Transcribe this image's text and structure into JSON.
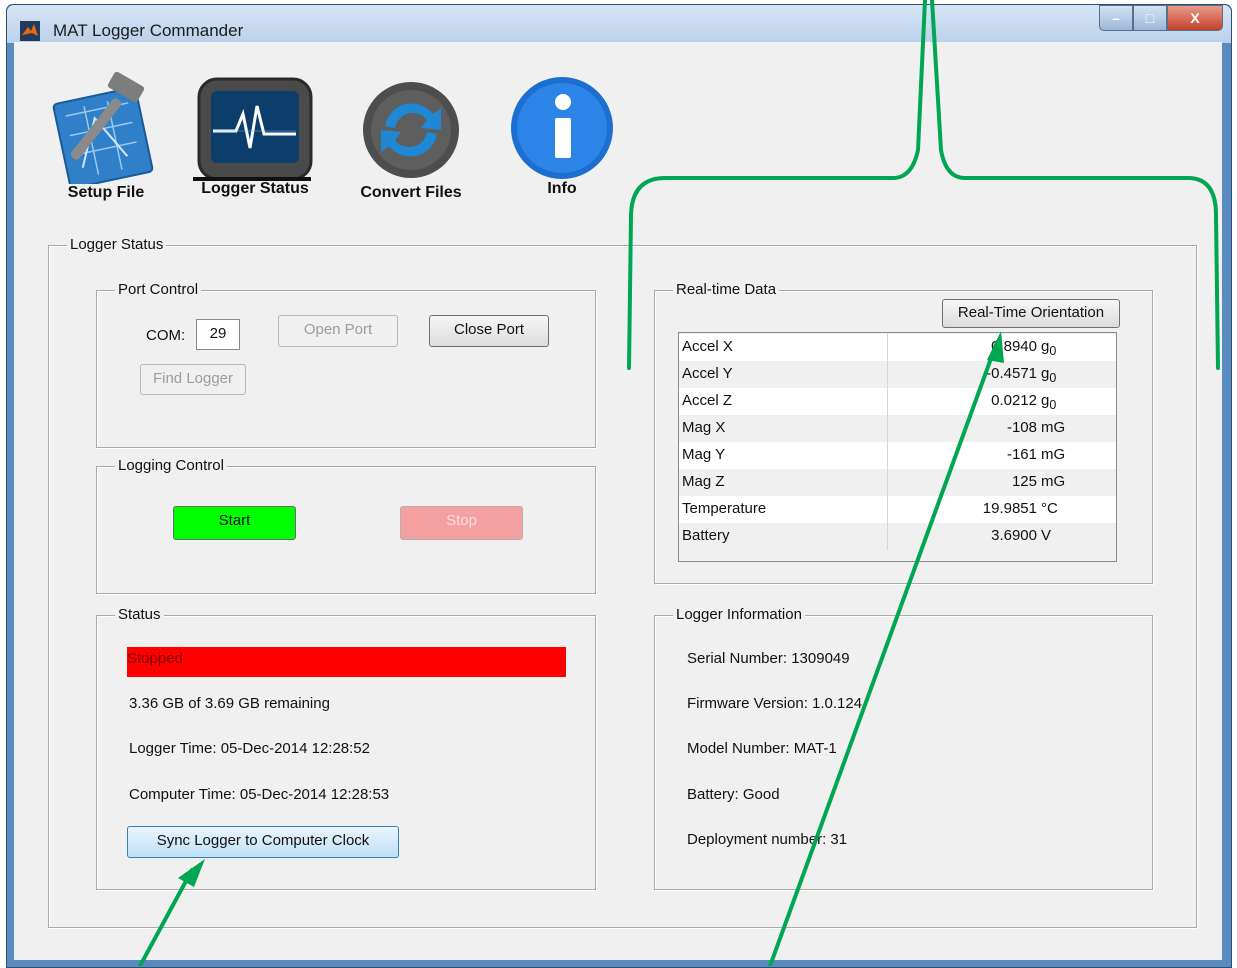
{
  "window": {
    "title": "MAT Logger Commander",
    "minimize": "–",
    "maximize": "□",
    "close": "X"
  },
  "toolbar": [
    {
      "label": "Setup File",
      "icon": "hammer-blueprint-icon"
    },
    {
      "label": "Logger Status",
      "icon": "monitor-pulse-icon"
    },
    {
      "label": "Convert Files",
      "icon": "refresh-arrows-icon"
    },
    {
      "label": "Info",
      "icon": "info-icon"
    }
  ],
  "logger_status": {
    "title": "Logger Status",
    "port_control": {
      "title": "Port Control",
      "com_label": "COM:",
      "com_value": "29",
      "open_port": "Open Port",
      "close_port": "Close Port",
      "find_logger": "Find Logger"
    },
    "logging_control": {
      "title": "Logging Control",
      "start": "Start",
      "stop": "Stop",
      "start_color": "#00ff00",
      "stop_color": "#f4a0a0"
    },
    "status": {
      "title": "Status",
      "state": "Stopped",
      "state_color": "#ff0000",
      "storage": "3.36 GB of 3.69 GB remaining",
      "logger_time": "Logger Time: 05-Dec-2014 12:28:52",
      "computer_time": "Computer Time: 05-Dec-2014 12:28:53",
      "sync_button": "Sync Logger to Computer Clock"
    },
    "realtime": {
      "title": "Real-time Data",
      "orientation_button": "Real-Time Orientation",
      "rows": [
        {
          "name": "Accel X",
          "value": "0.8940",
          "unit": "g",
          "sub": "0"
        },
        {
          "name": "Accel Y",
          "value": "-0.4571",
          "unit": "g",
          "sub": "0"
        },
        {
          "name": "Accel Z",
          "value": "0.0212",
          "unit": "g",
          "sub": "0"
        },
        {
          "name": "Mag X",
          "value": "-108",
          "unit": "mG",
          "sub": ""
        },
        {
          "name": "Mag Y",
          "value": "-161",
          "unit": "mG",
          "sub": ""
        },
        {
          "name": "Mag Z",
          "value": "125",
          "unit": "mG",
          "sub": ""
        },
        {
          "name": "Temperature",
          "value": "19.9851",
          "unit": "°C",
          "sub": ""
        },
        {
          "name": "Battery",
          "value": "3.6900",
          "unit": "V",
          "sub": ""
        }
      ]
    },
    "logger_info": {
      "title": "Logger Information",
      "serial": "Serial Number: 1309049",
      "firmware": "Firmware Version: 1.0.124",
      "model": "Model Number: MAT-1",
      "battery": "Battery: Good",
      "deployment": "Deployment number: 31"
    }
  },
  "annotation_color": "#00a651"
}
